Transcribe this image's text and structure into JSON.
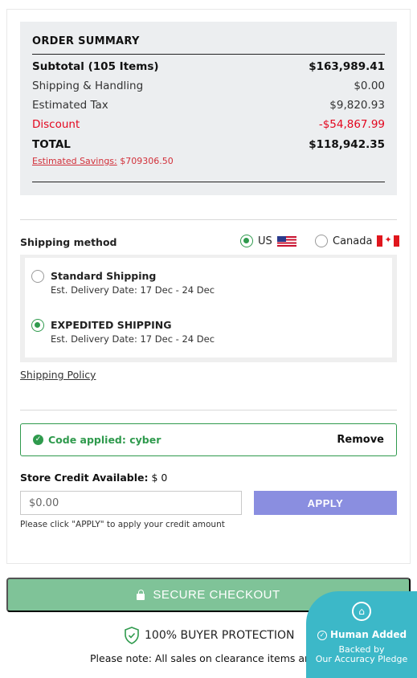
{
  "summary": {
    "title": "ORDER SUMMARY",
    "subtotal_label": "Subtotal (105 Items)",
    "subtotal_value": "$163,989.41",
    "shipping_label": "Shipping & Handling",
    "shipping_value": "$0.00",
    "tax_label": "Estimated Tax",
    "tax_value": "$9,820.93",
    "discount_label": "Discount",
    "discount_value": "-$54,867.99",
    "total_label": "TOTAL",
    "total_value": "$118,942.35",
    "savings_label": "Estimated Savings:",
    "savings_value": "$709306.50"
  },
  "shipping": {
    "label": "Shipping method",
    "countries": [
      {
        "label": "US",
        "selected": true,
        "flag": "us-flag-icon"
      },
      {
        "label": "Canada",
        "selected": false,
        "flag": "canada-flag-icon"
      }
    ],
    "options": [
      {
        "name": "Standard Shipping",
        "date": "Est. Delivery Date: 17 Dec - 24 Dec",
        "selected": false
      },
      {
        "name": "EXPEDITED SHIPPING",
        "date": "Est. Delivery Date: 17 Dec - 24 Dec",
        "selected": true
      }
    ],
    "policy_link": "Shipping Policy"
  },
  "coupon": {
    "applied_text": "Code applied: cyber",
    "remove_label": "Remove"
  },
  "store_credit": {
    "label": "Store Credit Available:",
    "amount": "$ 0",
    "input_placeholder": "$0.00",
    "apply_label": "APPLY",
    "hint": "Please click \"APPLY\" to apply your credit amount"
  },
  "checkout": {
    "button_label": "SECURE CHECKOUT",
    "protection": "100% BUYER PROTECTION",
    "note": "Please note: All sales on clearance items are final"
  },
  "badge": {
    "title": "Human Added",
    "line1": "Backed by",
    "line2": "Our Accuracy Pledge"
  },
  "colors": {
    "accent_green": "#2f9a4d",
    "discount_red": "#e3061e",
    "apply_purple": "#8a8ee0",
    "checkout_green": "#7fc398",
    "badge_teal": "#3cb8c8"
  }
}
